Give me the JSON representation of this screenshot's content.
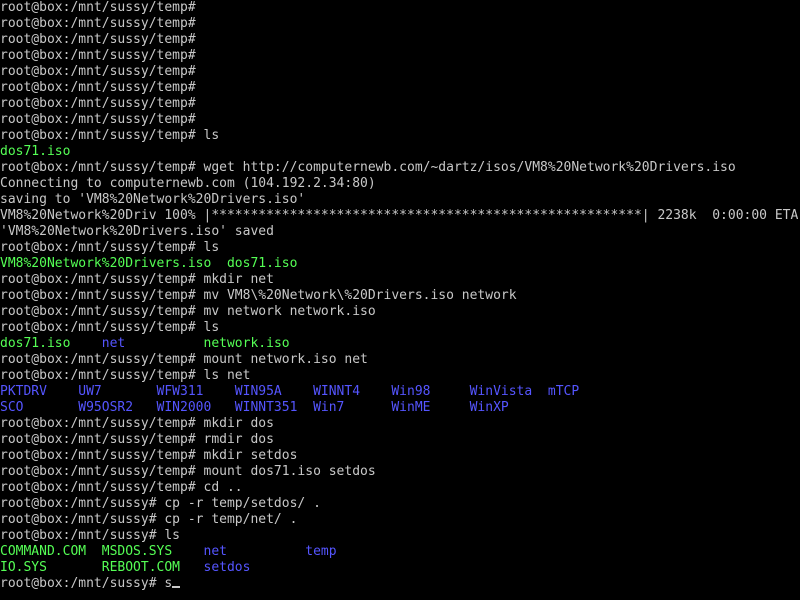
{
  "terminal": {
    "cursor_char": "_",
    "colors": {
      "default": "#c8c8c8",
      "iso": "#55ff55",
      "dir": "#5555ff"
    },
    "lines": [
      {
        "segments": [
          {
            "text": "root@box:/mnt/sussy/temp#",
            "color": "default"
          }
        ]
      },
      {
        "segments": [
          {
            "text": "root@box:/mnt/sussy/temp#",
            "color": "default"
          }
        ]
      },
      {
        "segments": [
          {
            "text": "root@box:/mnt/sussy/temp#",
            "color": "default"
          }
        ]
      },
      {
        "segments": [
          {
            "text": "root@box:/mnt/sussy/temp#",
            "color": "default"
          }
        ]
      },
      {
        "segments": [
          {
            "text": "root@box:/mnt/sussy/temp#",
            "color": "default"
          }
        ]
      },
      {
        "segments": [
          {
            "text": "root@box:/mnt/sussy/temp#",
            "color": "default"
          }
        ]
      },
      {
        "segments": [
          {
            "text": "root@box:/mnt/sussy/temp#",
            "color": "default"
          }
        ]
      },
      {
        "segments": [
          {
            "text": "root@box:/mnt/sussy/temp#",
            "color": "default"
          }
        ]
      },
      {
        "segments": [
          {
            "text": "root@box:/mnt/sussy/temp# ls",
            "color": "default"
          }
        ]
      },
      {
        "segments": [
          {
            "text": "dos71.iso",
            "color": "iso"
          }
        ]
      },
      {
        "segments": [
          {
            "text": "root@box:/mnt/sussy/temp# wget http://computernewb.com/~dartz/isos/VM8%20Network%20Drivers.iso",
            "color": "default"
          }
        ]
      },
      {
        "segments": [
          {
            "text": "Connecting to computernewb.com (104.192.2.34:80)",
            "color": "default"
          }
        ]
      },
      {
        "segments": [
          {
            "text": "saving to 'VM8%20Network%20Drivers.iso'",
            "color": "default"
          }
        ]
      },
      {
        "segments": [
          {
            "text": "VM8%20Network%20Driv 100% |*******************************************************| 2238k  0:00:00 ETA",
            "color": "default"
          }
        ]
      },
      {
        "segments": [
          {
            "text": "'VM8%20Network%20Drivers.iso' saved",
            "color": "default"
          }
        ]
      },
      {
        "segments": [
          {
            "text": "root@box:/mnt/sussy/temp# ls",
            "color": "default"
          }
        ]
      },
      {
        "segments": [
          {
            "text": "VM8%20Network%20Drivers.iso  dos71.iso",
            "color": "iso"
          }
        ]
      },
      {
        "segments": [
          {
            "text": "root@box:/mnt/sussy/temp# mkdir net",
            "color": "default"
          }
        ]
      },
      {
        "segments": [
          {
            "text": "root@box:/mnt/sussy/temp# mv VM8\\%20Network\\%20Drivers.iso network",
            "color": "default"
          }
        ]
      },
      {
        "segments": [
          {
            "text": "root@box:/mnt/sussy/temp# mv network network.iso",
            "color": "default"
          }
        ]
      },
      {
        "segments": [
          {
            "text": "root@box:/mnt/sussy/temp# ls",
            "color": "default"
          }
        ]
      },
      {
        "segments": [
          {
            "text": "dos71.iso    ",
            "color": "iso"
          },
          {
            "text": "net          ",
            "color": "dir"
          },
          {
            "text": "network.iso",
            "color": "iso"
          }
        ]
      },
      {
        "segments": [
          {
            "text": "root@box:/mnt/sussy/temp# mount network.iso net",
            "color": "default"
          }
        ]
      },
      {
        "segments": [
          {
            "text": "root@box:/mnt/sussy/temp# ls net",
            "color": "default"
          }
        ]
      },
      {
        "segments": [
          {
            "text": "PKTDRV    UW7       WFW311    WIN95A    WINNT4    Win98     WinVista  mTCP",
            "color": "dir"
          }
        ]
      },
      {
        "segments": [
          {
            "text": "SCO       W95OSR2   WIN2000   WINNT351  Win7      WinME     WinXP",
            "color": "dir"
          }
        ]
      },
      {
        "segments": [
          {
            "text": "root@box:/mnt/sussy/temp# mkdir dos",
            "color": "default"
          }
        ]
      },
      {
        "segments": [
          {
            "text": "root@box:/mnt/sussy/temp# rmdir dos",
            "color": "default"
          }
        ]
      },
      {
        "segments": [
          {
            "text": "root@box:/mnt/sussy/temp# mkdir setdos",
            "color": "default"
          }
        ]
      },
      {
        "segments": [
          {
            "text": "root@box:/mnt/sussy/temp# mount dos71.iso setdos",
            "color": "default"
          }
        ]
      },
      {
        "segments": [
          {
            "text": "root@box:/mnt/sussy/temp# cd ..",
            "color": "default"
          }
        ]
      },
      {
        "segments": [
          {
            "text": "root@box:/mnt/sussy# cp -r temp/setdos/ .",
            "color": "default"
          }
        ]
      },
      {
        "segments": [
          {
            "text": "root@box:/mnt/sussy# cp -r temp/net/ .",
            "color": "default"
          }
        ]
      },
      {
        "segments": [
          {
            "text": "root@box:/mnt/sussy# ls",
            "color": "default"
          }
        ]
      },
      {
        "segments": [
          {
            "text": "COMMAND.COM  MSDOS.SYS    ",
            "color": "iso"
          },
          {
            "text": "net          temp",
            "color": "dir"
          }
        ]
      },
      {
        "segments": [
          {
            "text": "IO.SYS       REBOOT.COM   ",
            "color": "iso"
          },
          {
            "text": "setdos",
            "color": "dir"
          }
        ]
      },
      {
        "segments": [
          {
            "text": "root@box:/mnt/sussy# s",
            "color": "default"
          }
        ]
      }
    ]
  }
}
